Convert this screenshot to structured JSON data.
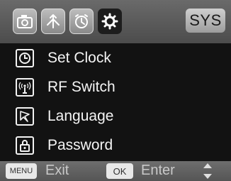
{
  "tabs": [
    {
      "icon": "camera-icon",
      "active": false
    },
    {
      "icon": "trail-icon",
      "active": false
    },
    {
      "icon": "timer-icon",
      "active": false
    },
    {
      "icon": "gear-icon",
      "active": true
    }
  ],
  "header": {
    "sys_label": "SYS"
  },
  "menu": {
    "items": [
      {
        "icon": "clock-icon",
        "label": "Set Clock"
      },
      {
        "icon": "rf-switch-icon",
        "label": "RF Switch"
      },
      {
        "icon": "language-icon",
        "label": "Language"
      },
      {
        "icon": "lock-icon",
        "label": "Password"
      }
    ]
  },
  "footer": {
    "menu_key": "MENU",
    "exit_label": "Exit",
    "ok_key": "OK",
    "enter_label": "Enter",
    "nav_icon": "up-down-arrows-icon"
  }
}
